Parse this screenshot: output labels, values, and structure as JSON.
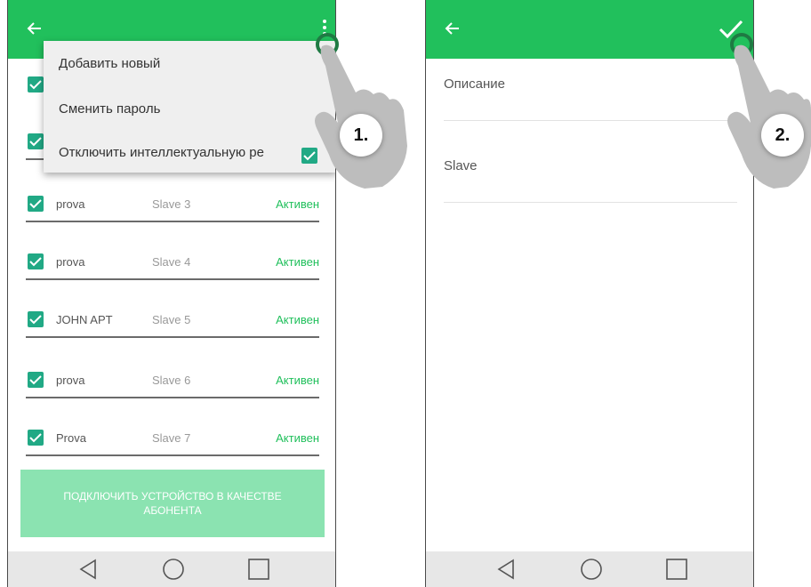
{
  "colors": {
    "appbar": "#21c05c",
    "accent": "#21c05c",
    "checkbox": "#21a985",
    "button_disabled": "#8be3b1"
  },
  "left_screen": {
    "menu": {
      "items": [
        "Добавить новый",
        "Сменить пароль",
        "Отключить интеллектуальную ре"
      ],
      "toggle_checked": true
    },
    "rows": [
      {
        "name": "prova",
        "type": "Slave 3",
        "status": "Активен"
      },
      {
        "name": "prova",
        "type": "Slave 4",
        "status": "Активен"
      },
      {
        "name": "JOHN APT",
        "type": "Slave 5",
        "status": "Активен"
      },
      {
        "name": "prova",
        "type": "Slave 6",
        "status": "Активен"
      },
      {
        "name": "Prova",
        "type": "Slave 7",
        "status": "Активен"
      }
    ],
    "connect_button": "ПОДКЛЮЧИТЬ УСТРОЙСТВО В КАЧЕСТВЕ АБОНЕНТА",
    "step_badge": "1."
  },
  "right_screen": {
    "fields": [
      {
        "label": "Описание"
      },
      {
        "label": "Slave"
      }
    ],
    "step_badge": "2."
  },
  "icons": [
    "back-arrow-icon",
    "overflow-menu-icon",
    "checkmark-icon",
    "nav-back-icon",
    "nav-home-icon",
    "nav-recents-icon",
    "pointing-hand-icon"
  ]
}
